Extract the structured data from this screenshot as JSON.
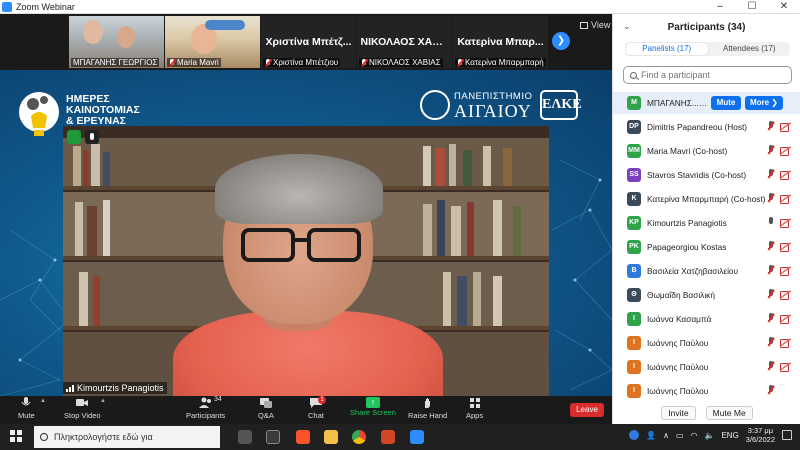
{
  "window": {
    "title": "Zoom Webinar",
    "controls": [
      "–",
      "☐",
      "✕"
    ]
  },
  "gallery": {
    "tiles": [
      {
        "label": "ΜΠΑΓΑΝΗΣ ΓΕΩΡΓΙΟΣ",
        "type": "video",
        "muted": false
      },
      {
        "label": "Maria Mavri",
        "type": "video",
        "muted": true
      },
      {
        "big_name": "Χριστίνα Μπέτζ...",
        "label": "Χριστίνα Μπέτζιου",
        "type": "name",
        "muted": true
      },
      {
        "big_name": "ΝΙΚΟΛΑΟΣ ΧΑΒ...",
        "label": "ΝΙΚΟΛΑΟΣ ΧΑΒΙΑΣ",
        "type": "name",
        "muted": true
      },
      {
        "big_name": "Κατερίνα Μπαρ...",
        "label": "Κατερίνα Μπαρμπαρή",
        "type": "name",
        "muted": true
      }
    ],
    "next_icon": "chevron-right-icon",
    "view_label": "View"
  },
  "stage": {
    "brand_lines": [
      "ΗΜΕΡΕΣ",
      "ΚΑΙΝΟΤΟΜΙΑΣ",
      "& ΕΡΕΥΝΑΣ"
    ],
    "university_line1": "ΠΑΝΕΠΙΣΤΗΜΙΟ",
    "university_line2": "ΑΙΓΑΙΟΥ",
    "elke_logo": "ΕΛΚΕ",
    "speaker_name": "Kimourtzis Panagiotis"
  },
  "toolbar": {
    "mute": "Mute",
    "stop_video": "Stop Video",
    "participants": "Participants",
    "participants_count": "34",
    "qa": "Q&A",
    "chat": "Chat",
    "chat_badge": "1",
    "share": "Share Screen",
    "raise_hand": "Raise Hand",
    "apps": "Apps",
    "leave": "Leave"
  },
  "panel": {
    "title": "Participants (34)",
    "tabs": {
      "panelists": "Panelists (17)",
      "attendees": "Attendees (17)"
    },
    "search_placeholder": "Find a participant",
    "me_buttons": {
      "mute": "Mute",
      "more": "More ❯"
    },
    "participants": [
      {
        "initials": "M",
        "name": "ΜΠΑΓΑΝΗΣ... (Me)",
        "color": "#2fa34a",
        "me": true
      },
      {
        "initials": "DP",
        "name": "Dimitris Papandreou (Host)",
        "color": "#3b4a5a",
        "mic": "muted",
        "cam": "off"
      },
      {
        "initials": "MM",
        "name": "Maria Mavri (Co-host)",
        "color": "#2fa34a",
        "mic": "muted",
        "cam": "off"
      },
      {
        "initials": "SS",
        "name": "Stavros Stavridis (Co-host)",
        "color": "#7b3fbf",
        "mic": "muted",
        "cam": "off"
      },
      {
        "initials": "K",
        "name": "Κατερίνα Μπαρμπαρή (Co-host)",
        "color": "#3b4a5a",
        "mic": "muted",
        "cam": "off"
      },
      {
        "initials": "KP",
        "name": "Kimourtzis Panagiotis",
        "color": "#2fa34a",
        "mic": "on",
        "cam": "off"
      },
      {
        "initials": "PK",
        "name": "Papageorgiou Kostas",
        "color": "#2fa34a",
        "mic": "muted",
        "cam": "off"
      },
      {
        "initials": "B",
        "name": "Βασιλεία Χατζηβασιλείου",
        "color": "#2f7be0",
        "mic": "muted",
        "cam": "off"
      },
      {
        "initials": "Θ",
        "name": "Θωμαΐδη Βασιλική",
        "color": "#3b4a5a",
        "mic": "muted",
        "cam": "off"
      },
      {
        "initials": "I",
        "name": "Ιωάννα Κασαμπά",
        "color": "#2fa34a",
        "mic": "muted",
        "cam": "off"
      },
      {
        "initials": "I",
        "name": "Ιωάννης Παύλου",
        "color": "#e0731f",
        "mic": "muted",
        "cam": "off"
      },
      {
        "initials": "I",
        "name": "Ιωάννης Παύλου",
        "color": "#e0731f",
        "mic": "muted",
        "cam": "off"
      },
      {
        "initials": "I",
        "name": "Ιωάννης Παύλου",
        "color": "#e0731f",
        "mic": "muted",
        "cam": "none"
      }
    ],
    "footer": {
      "invite": "Invite",
      "mute_me": "Mute Me"
    }
  },
  "taskbar": {
    "search_placeholder": "Πληκτρολογήστε εδώ για",
    "language": "ENG",
    "time": "3:37 μμ",
    "date": "3/6/2022"
  }
}
